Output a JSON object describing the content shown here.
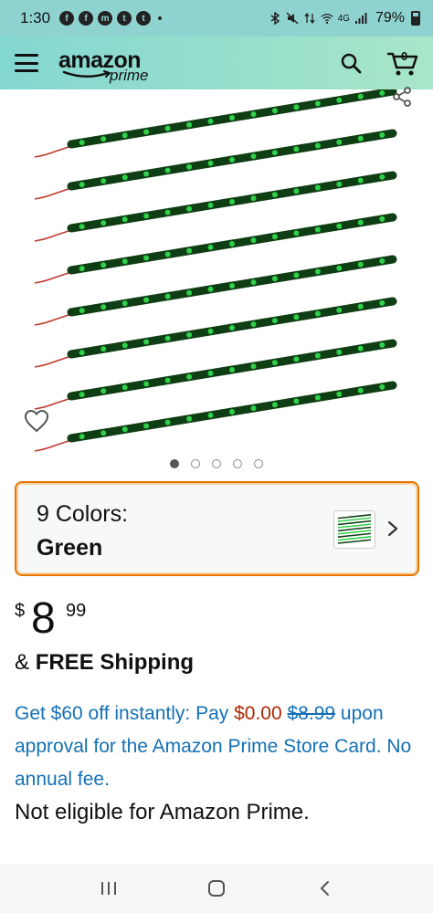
{
  "status_bar": {
    "time": "1:30",
    "notification_icons": [
      "facebook-icon",
      "facebook-icon",
      "messenger-icon",
      "tumblr-icon",
      "tumblr-icon"
    ],
    "network": "4G",
    "battery": "79%"
  },
  "header": {
    "logo_word": "amazon",
    "logo_sub": "prime",
    "cart_count": "0",
    "icons": [
      "menu-icon",
      "search-icon",
      "cart-icon"
    ]
  },
  "product": {
    "image_count": 5,
    "active_image": 0,
    "image_description_colors": {
      "strip": "#0f3d14",
      "led": "#2fd14a",
      "wire": "#c0392b"
    }
  },
  "variation": {
    "label": "9 Colors:",
    "value": "Green"
  },
  "price": {
    "symbol": "$",
    "whole": "8",
    "fraction": "99"
  },
  "shipping": {
    "prefix": "& ",
    "text": "FREE Shipping"
  },
  "offer": {
    "part1": "Get $60 off instantly: Pay ",
    "pay_amount": "$0.00",
    "original_price": "$8.99",
    "part2": "upon approval for the Amazon Prime Store Card. No annual fee."
  },
  "prime_note": "Not eligible for Amazon Prime.",
  "colors": {
    "status_bar": "#8fd3d0",
    "header_start": "#83d7d1",
    "header_end": "#a8e6c8",
    "link": "#1470b5",
    "price_red": "#b12704",
    "selector_border": "#e77600"
  }
}
